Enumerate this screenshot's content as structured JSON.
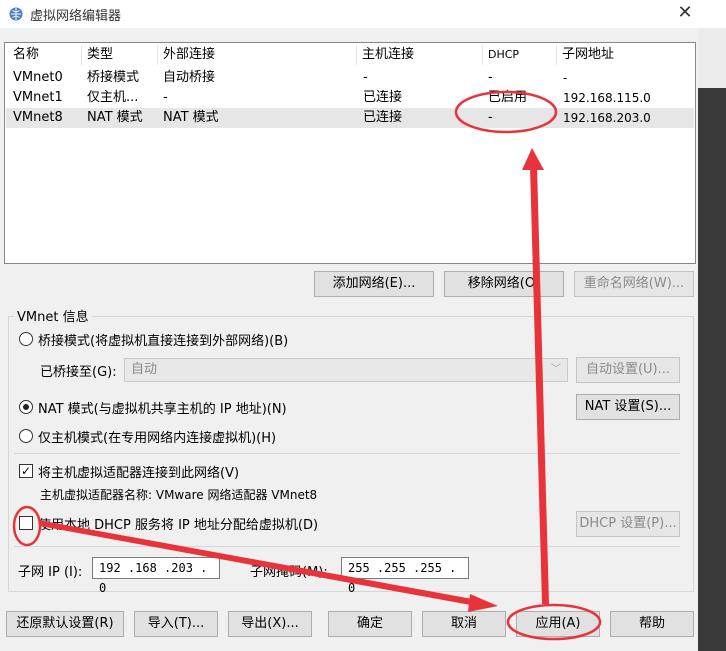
{
  "window": {
    "title": "虚拟网络编辑器",
    "close": "✕"
  },
  "table": {
    "columns": [
      "名称",
      "类型",
      "外部连接",
      "主机连接",
      "DHCP",
      "子网地址"
    ],
    "rows": [
      {
        "name": "VMnet0",
        "type": "桥接模式",
        "external": "自动桥接",
        "host": "-",
        "dhcp": "-",
        "subnet": "-"
      },
      {
        "name": "VMnet1",
        "type": "仅主机...",
        "external": "-",
        "host": "已连接",
        "dhcp": "已启用",
        "subnet": "192.168.115.0"
      },
      {
        "name": "VMnet8",
        "type": "NAT 模式",
        "external": "NAT 模式",
        "host": "已连接",
        "dhcp": "-",
        "subnet": "192.168.203.0"
      }
    ]
  },
  "list_buttons": {
    "add": "添加网络(E)...",
    "remove": "移除网络(O)",
    "rename": "重命名网络(W)..."
  },
  "group": {
    "title": "VMnet 信息",
    "bridge_radio": "桥接模式(将虚拟机直接连接到外部网络)(B)",
    "bridged_to_label": "已桥接至(G):",
    "bridged_to_value": "自动",
    "auto_settings": "自动设置(U)...",
    "nat_radio": "NAT 模式(与虚拟机共享主机的 IP 地址)(N)",
    "nat_settings": "NAT 设置(S)...",
    "hostonly_radio": "仅主机模式(在专用网络内连接虚拟机)(H)",
    "connect_adapter": "将主机虚拟适配器连接到此网络(V)",
    "adapter_name": "主机虚拟适配器名称: VMware 网络适配器 VMnet8",
    "use_dhcp": "使用本地 DHCP 服务将 IP 地址分配给虚拟机(D)",
    "dhcp_settings": "DHCP 设置(P)...",
    "subnet_ip_label": "子网 IP (I):",
    "subnet_ip_value": "192 .168 .203 . 0",
    "subnet_mask_label": "子网掩码(M):",
    "subnet_mask_value": "255 .255 .255 . 0"
  },
  "footer": {
    "restore": "还原默认设置(R)",
    "import": "导入(T)...",
    "export": "导出(X)...",
    "ok": "确定",
    "cancel": "取消",
    "apply": "应用(A)",
    "help": "帮助"
  },
  "state": {
    "selected_row": "VMnet8",
    "nat_checked": true,
    "connect_adapter_checked": true,
    "use_dhcp_checked": false
  },
  "colors": {
    "annotation_red": "#e8333a",
    "selected_row_bg": "#e6e6e6"
  }
}
